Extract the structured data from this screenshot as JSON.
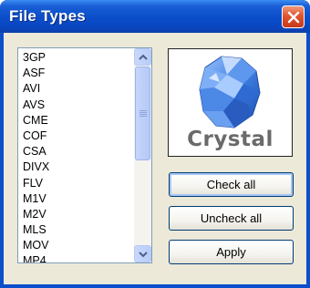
{
  "window": {
    "title": "File Types"
  },
  "file_list": {
    "items": [
      "3GP",
      "ASF",
      "AVI",
      "AVS",
      "CME",
      "COF",
      "CSA",
      "DIVX",
      "FLV",
      "M1V",
      "M2V",
      "MLS",
      "MOV",
      "MP4"
    ]
  },
  "logo": {
    "text": "Crystal"
  },
  "buttons": {
    "check_all": "Check all",
    "uncheck_all": "Uncheck all",
    "apply": "Apply"
  },
  "colors": {
    "titlebar": "#0b4fcb",
    "close_button": "#e0542f",
    "dialog_background": "#ece9d8",
    "crystal_blue": "#3f7fe0"
  }
}
